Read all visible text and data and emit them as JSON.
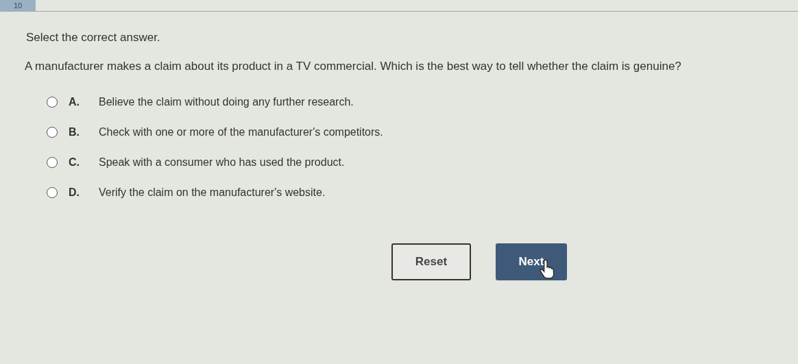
{
  "question_number": "10",
  "instruction": "Select the correct answer.",
  "question": "A manufacturer makes a claim about its product in a TV commercial. Which is the best way to tell whether the claim is genuine?",
  "options": [
    {
      "letter": "A.",
      "text": "Believe the claim without doing any further research.",
      "selected": false
    },
    {
      "letter": "B.",
      "text": "Check with one or more of the manufacturer's competitors.",
      "selected": false
    },
    {
      "letter": "C.",
      "text": "Speak with a consumer who has used the product.",
      "selected": false
    },
    {
      "letter": "D.",
      "text": "Verify the claim on the manufacturer's website.",
      "selected": false
    }
  ],
  "buttons": [
    {
      "label": "Reset",
      "kind": "secondary"
    },
    {
      "label": "Next",
      "kind": "primary"
    }
  ]
}
